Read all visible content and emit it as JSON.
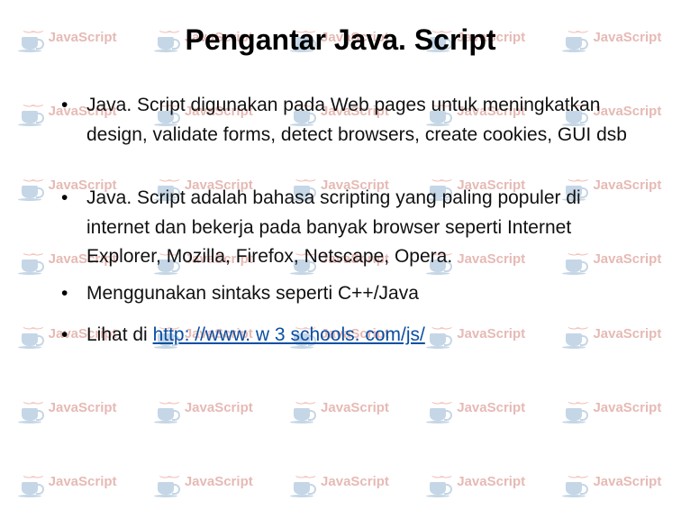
{
  "bg_label": "JavaScript",
  "slide": {
    "title": "Pengantar Java. Script",
    "bullets": [
      "Java. Script digunakan pada Web pages untuk meningkatkan design, validate forms, detect browsers, create cookies, GUI dsb",
      "Java. Script adalah bahasa scripting yang paling populer di internet dan bekerja pada banyak browser seperti Internet Explorer, Mozilla, Firefox, Netscape, Opera.",
      "Menggunakan sintaks seperti C++/Java",
      "Lihat di "
    ],
    "link_text": "http: //www. w 3 schools. com/js/"
  }
}
